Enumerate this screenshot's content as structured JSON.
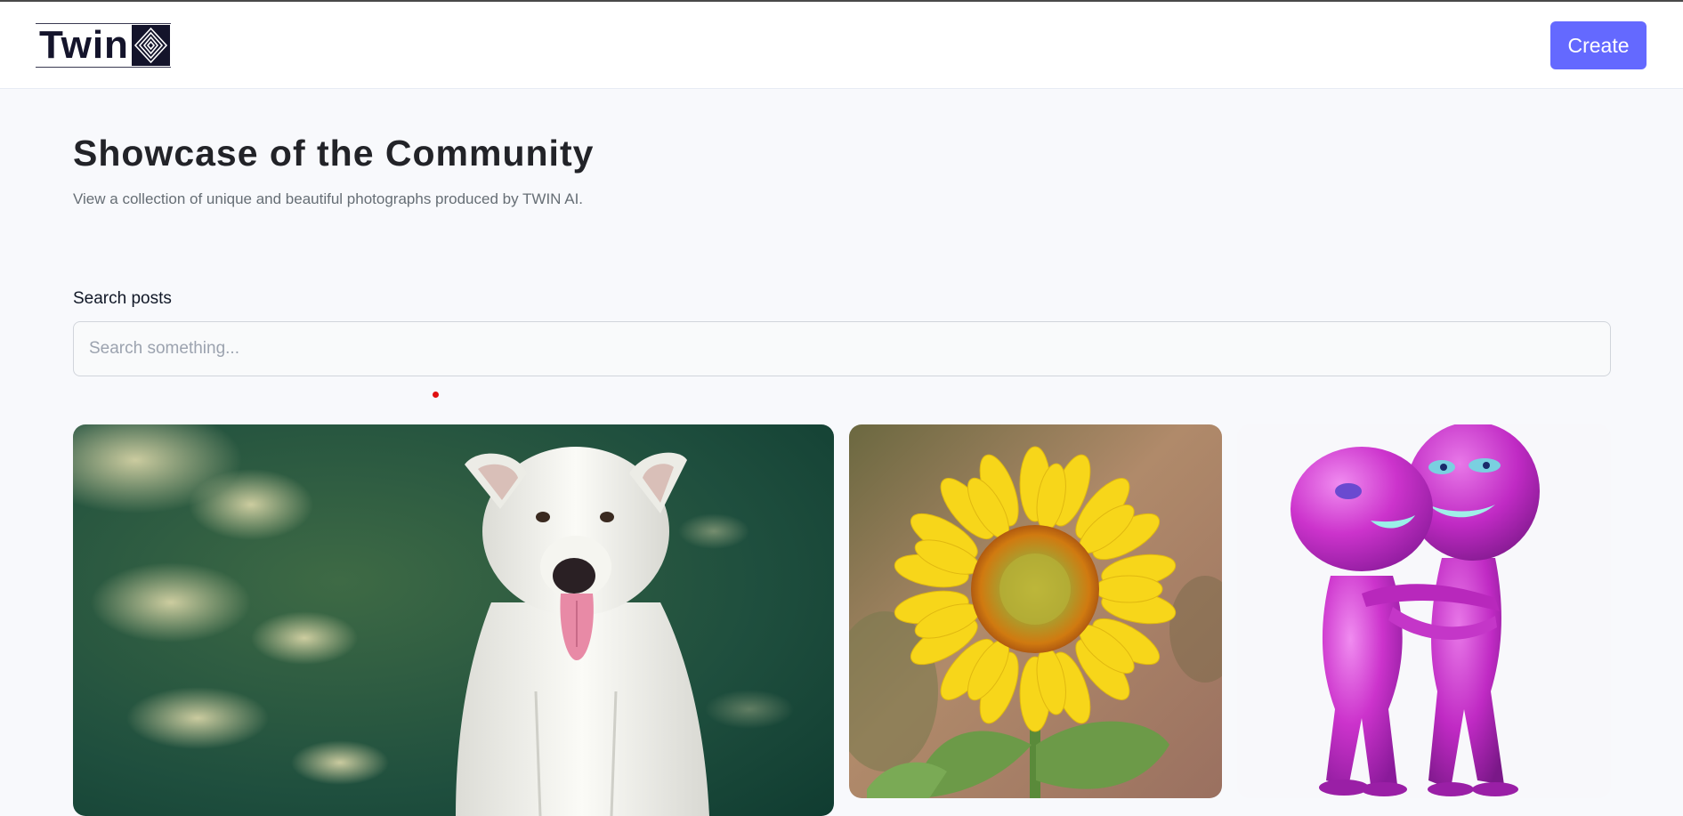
{
  "header": {
    "logo_text": "Twin",
    "create_label": "Create"
  },
  "hero": {
    "title": "Showcase of the Community",
    "subtitle": "View a collection of unique and beautiful photographs produced by TWIN AI."
  },
  "search": {
    "label": "Search posts",
    "placeholder": "Search something...",
    "value": ""
  },
  "gallery": {
    "cards": [
      {
        "subject": "white-dog"
      },
      {
        "subject": "sunflower"
      },
      {
        "subject": "purple-figures-hugging"
      }
    ]
  },
  "colors": {
    "accent": "#6469ff",
    "background": "#f8f9fc",
    "title": "#222328",
    "subtitle": "#666e75"
  }
}
